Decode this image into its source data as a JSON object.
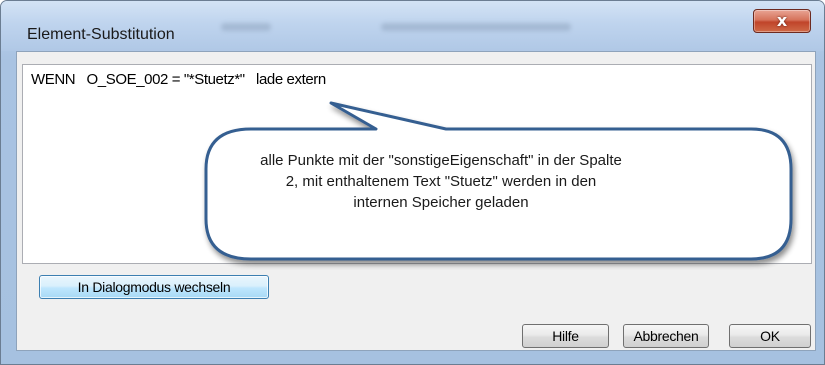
{
  "window": {
    "title": "Element-Substitution",
    "close_glyph": "x"
  },
  "editor": {
    "content": "WENN   O_SOE_002 = \"*Stuetz*\"   lade extern"
  },
  "callout": {
    "lines": [
      "alle Punkte mit der \"sonstigeEigenschaft\" in der Spalte",
      "2, mit enthaltenem Text \"Stuetz\" werden in den",
      "internen Speicher geladen"
    ]
  },
  "buttons": {
    "dialog_mode": "In Dialogmodus wechseln",
    "help": "Hilfe",
    "cancel": "Abbrechen",
    "ok": "OK"
  },
  "colors": {
    "callout_border": "#365f91",
    "close_button": "#c8472c",
    "title_bar": "#bfd4ee"
  }
}
